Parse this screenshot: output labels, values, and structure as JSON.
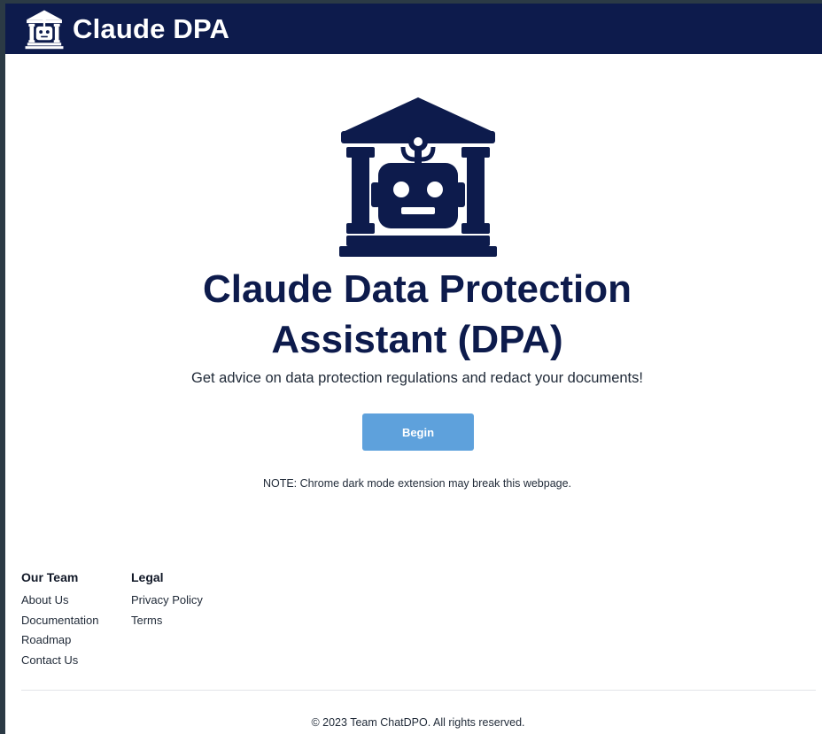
{
  "navbar": {
    "logo_icon": "bank-robot-icon",
    "title": "Claude DPA"
  },
  "hero": {
    "logo_icon": "bank-robot-icon",
    "title_line1": "Claude Data Protection",
    "title_line2": "Assistant (DPA)",
    "subtitle": "Get advice on data protection regulations and redact your documents!",
    "begin_label": "Begin",
    "note": "NOTE: Chrome dark mode extension may break this webpage."
  },
  "footer": {
    "team": {
      "heading": "Our Team",
      "links": [
        "About Us",
        "Documentation",
        "Roadmap",
        "Contact Us"
      ]
    },
    "legal": {
      "heading": "Legal",
      "links": [
        "Privacy Policy",
        "Terms"
      ]
    },
    "copyright": "© 2023 Team ChatDPO. All rights reserved."
  },
  "colors": {
    "navbar_bg": "#0d1b4c",
    "brand_navy": "#0d1b4c",
    "button_bg": "#5ea1dc",
    "page_bg": "#ffffff"
  }
}
